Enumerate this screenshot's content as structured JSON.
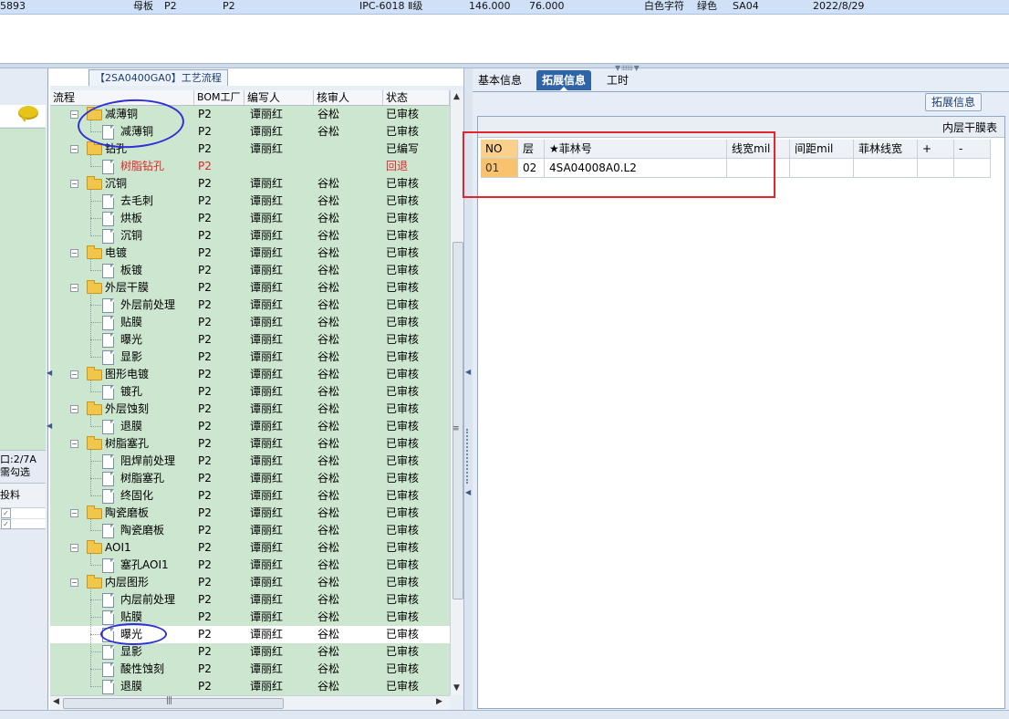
{
  "top_row": {
    "id": "5893",
    "part": "母板",
    "bom_a": "P2",
    "bom_b": "P2",
    "spec": "IPC-6018 Ⅱ级",
    "v1": "146.000",
    "v2": "76.000",
    "silk": "白色字符",
    "mask": "绿色",
    "code": "SA04",
    "date": "2022/8/29"
  },
  "left_panel": {
    "info_line1": "口:2/7A",
    "info_line2": "需勾选",
    "table_header": "投料"
  },
  "tree": {
    "title": "【2SA0400GA0】工艺流程",
    "columns": [
      "流程",
      "BOM工厂",
      "编写人",
      "核审人",
      "状态"
    ],
    "rows": [
      {
        "name": "减薄铜",
        "level": 0,
        "bom": "P2",
        "writer": "谭丽红",
        "reviewer": "谷松",
        "status": "已审核"
      },
      {
        "name": "减薄铜",
        "level": 1,
        "bom": "P2",
        "writer": "谭丽红",
        "reviewer": "谷松",
        "status": "已审核"
      },
      {
        "name": "钻孔",
        "level": 0,
        "bom": "P2",
        "writer": "谭丽红",
        "reviewer": "",
        "status": "已编写"
      },
      {
        "name": "树脂钻孔",
        "level": 1,
        "bom": "P2",
        "writer": "",
        "reviewer": "",
        "status": "回退",
        "red": true
      },
      {
        "name": "沉铜",
        "level": 0,
        "bom": "P2",
        "writer": "谭丽红",
        "reviewer": "谷松",
        "status": "已审核"
      },
      {
        "name": "去毛刺",
        "level": 1,
        "bom": "P2",
        "writer": "谭丽红",
        "reviewer": "谷松",
        "status": "已审核"
      },
      {
        "name": "烘板",
        "level": 1,
        "bom": "P2",
        "writer": "谭丽红",
        "reviewer": "谷松",
        "status": "已审核"
      },
      {
        "name": "沉铜",
        "level": 1,
        "bom": "P2",
        "writer": "谭丽红",
        "reviewer": "谷松",
        "status": "已审核"
      },
      {
        "name": "电镀",
        "level": 0,
        "bom": "P2",
        "writer": "谭丽红",
        "reviewer": "谷松",
        "status": "已审核"
      },
      {
        "name": "板镀",
        "level": 1,
        "bom": "P2",
        "writer": "谭丽红",
        "reviewer": "谷松",
        "status": "已审核"
      },
      {
        "name": "外层干膜",
        "level": 0,
        "bom": "P2",
        "writer": "谭丽红",
        "reviewer": "谷松",
        "status": "已审核"
      },
      {
        "name": "外层前处理",
        "level": 1,
        "bom": "P2",
        "writer": "谭丽红",
        "reviewer": "谷松",
        "status": "已审核"
      },
      {
        "name": "贴膜",
        "level": 1,
        "bom": "P2",
        "writer": "谭丽红",
        "reviewer": "谷松",
        "status": "已审核"
      },
      {
        "name": "曝光",
        "level": 1,
        "bom": "P2",
        "writer": "谭丽红",
        "reviewer": "谷松",
        "status": "已审核"
      },
      {
        "name": "显影",
        "level": 1,
        "bom": "P2",
        "writer": "谭丽红",
        "reviewer": "谷松",
        "status": "已审核"
      },
      {
        "name": "图形电镀",
        "level": 0,
        "bom": "P2",
        "writer": "谭丽红",
        "reviewer": "谷松",
        "status": "已审核"
      },
      {
        "name": "镀孔",
        "level": 1,
        "bom": "P2",
        "writer": "谭丽红",
        "reviewer": "谷松",
        "status": "已审核"
      },
      {
        "name": "外层蚀刻",
        "level": 0,
        "bom": "P2",
        "writer": "谭丽红",
        "reviewer": "谷松",
        "status": "已审核"
      },
      {
        "name": "退膜",
        "level": 1,
        "bom": "P2",
        "writer": "谭丽红",
        "reviewer": "谷松",
        "status": "已审核"
      },
      {
        "name": "树脂塞孔",
        "level": 0,
        "bom": "P2",
        "writer": "谭丽红",
        "reviewer": "谷松",
        "status": "已审核"
      },
      {
        "name": "阻焊前处理",
        "level": 1,
        "bom": "P2",
        "writer": "谭丽红",
        "reviewer": "谷松",
        "status": "已审核"
      },
      {
        "name": "树脂塞孔",
        "level": 1,
        "bom": "P2",
        "writer": "谭丽红",
        "reviewer": "谷松",
        "status": "已审核"
      },
      {
        "name": "终固化",
        "level": 1,
        "bom": "P2",
        "writer": "谭丽红",
        "reviewer": "谷松",
        "status": "已审核"
      },
      {
        "name": "陶瓷磨板",
        "level": 0,
        "bom": "P2",
        "writer": "谭丽红",
        "reviewer": "谷松",
        "status": "已审核"
      },
      {
        "name": "陶瓷磨板",
        "level": 1,
        "bom": "P2",
        "writer": "谭丽红",
        "reviewer": "谷松",
        "status": "已审核"
      },
      {
        "name": "AOI1",
        "level": 0,
        "bom": "P2",
        "writer": "谭丽红",
        "reviewer": "谷松",
        "status": "已审核"
      },
      {
        "name": "塞孔AOI1",
        "level": 1,
        "bom": "P2",
        "writer": "谭丽红",
        "reviewer": "谷松",
        "status": "已审核"
      },
      {
        "name": "内层图形",
        "level": 0,
        "bom": "P2",
        "writer": "谭丽红",
        "reviewer": "谷松",
        "status": "已审核"
      },
      {
        "name": "内层前处理",
        "level": 1,
        "bom": "P2",
        "writer": "谭丽红",
        "reviewer": "谷松",
        "status": "已审核"
      },
      {
        "name": "贴膜",
        "level": 1,
        "bom": "P2",
        "writer": "谭丽红",
        "reviewer": "谷松",
        "status": "已审核"
      },
      {
        "name": "曝光",
        "level": 1,
        "bom": "P2",
        "writer": "谭丽红",
        "reviewer": "谷松",
        "status": "已审核",
        "selected": true
      },
      {
        "name": "显影",
        "level": 1,
        "bom": "P2",
        "writer": "谭丽红",
        "reviewer": "谷松",
        "status": "已审核"
      },
      {
        "name": "酸性蚀刻",
        "level": 1,
        "bom": "P2",
        "writer": "谭丽红",
        "reviewer": "谷松",
        "status": "已审核"
      },
      {
        "name": "退膜",
        "level": 1,
        "bom": "P2",
        "writer": "谭丽红",
        "reviewer": "谷松",
        "status": "已审核"
      }
    ]
  },
  "right": {
    "tabs": [
      "基本信息",
      "拓展信息",
      "工时"
    ],
    "active_tab": 1,
    "ext_button": "拓展信息",
    "grid_caption": "内层干膜表",
    "columns": [
      "NO",
      "层",
      "★菲林号",
      "线宽mil",
      "间距mil",
      "菲林线宽",
      "+",
      "-"
    ],
    "rows": [
      [
        "01",
        "02",
        "4SA04008A0.L2",
        "",
        "",
        "",
        "",
        ""
      ]
    ]
  },
  "colors": {
    "tree_green": "#cce6cf",
    "active_tab": "#2f64a8",
    "annotation_red": "#e0262b",
    "annotation_blue": "#2f2fd6",
    "rollback_red": "#e0262b"
  }
}
